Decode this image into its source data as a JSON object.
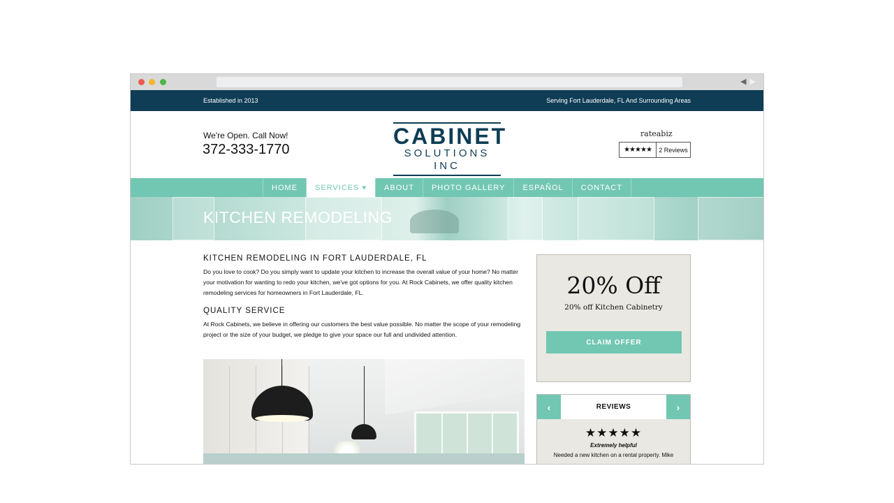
{
  "topbar": {
    "left": "Established in 2013",
    "right": "Serving Fort Lauderdale, FL And Surrounding Areas"
  },
  "header": {
    "open_text": "We're Open. Call Now!",
    "phone": "372-333-1770",
    "logo_line1": "CABINET",
    "logo_line2": "SOLUTIONS INC",
    "rate_brand": "rateabiz",
    "rate_stars": "★★★★★",
    "rate_count": "2 Reviews"
  },
  "nav": {
    "items": [
      {
        "label": "HOME"
      },
      {
        "label": "SERVICES ▾"
      },
      {
        "label": "ABOUT"
      },
      {
        "label": "PHOTO GALLERY"
      },
      {
        "label": "ESPAÑOL"
      },
      {
        "label": "CONTACT"
      }
    ]
  },
  "hero": {
    "title": "KITCHEN REMODELING"
  },
  "main": {
    "heading1": "KITCHEN REMODELING IN FORT LAUDERDALE, FL",
    "para1": "Do you love to cook? Do you simply want to update your kitchen to increase the overall value of your home? No matter your motivation for wanting to redo your kitchen, we've got options for you. At Rock Cabinets, we offer quality kitchen remodeling services for homeowners in Fort Lauderdale, FL.",
    "heading2": "QUALITY SERVICE",
    "para2": "At Rock Cabinets, we believe in offering our customers the best value possible. No matter the scope of your remodeling project or the size of your budget, we pledge to give your space our full and undivided attention."
  },
  "offer": {
    "headline": "20% Off",
    "subline": "20% off Kitchen Cabinetry",
    "button": "CLAIM OFFER"
  },
  "reviews": {
    "title": "REVIEWS",
    "prev": "‹",
    "next": "›",
    "stars": "★★★★★",
    "quote": "Extremely helpful",
    "text": "Needed a new kitchen on a rental property. Mike"
  },
  "colors": {
    "navy": "#0e3d55",
    "teal": "#72c7b2",
    "panel": "#eae8e2"
  }
}
